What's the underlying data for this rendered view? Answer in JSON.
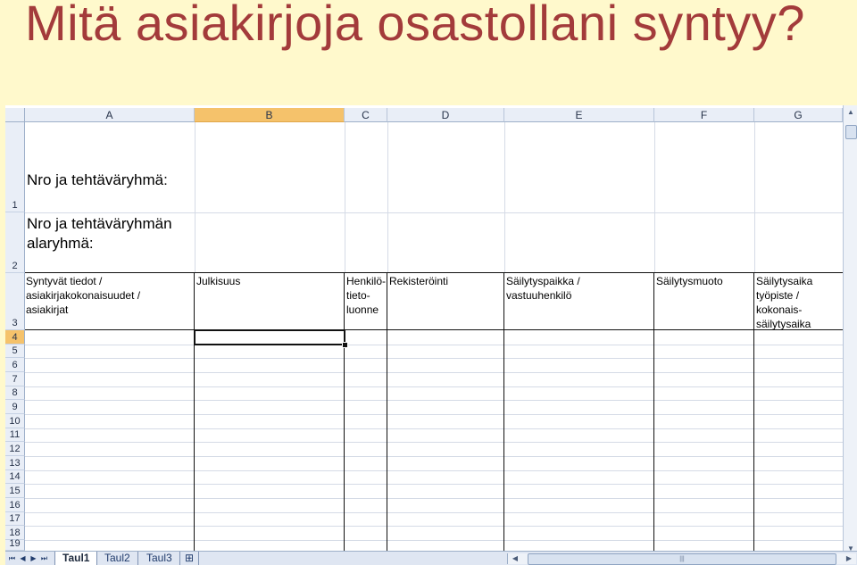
{
  "slide": {
    "title": "Mitä asiakirjoja osastollani syntyy?",
    "title_color": "#a33b3b",
    "background": "#fff9cc"
  },
  "sheet": {
    "columns": [
      "A",
      "B",
      "C",
      "D",
      "E",
      "F",
      "G"
    ],
    "selected_column": "B",
    "rows": [
      "1",
      "2",
      "3",
      "4",
      "5",
      "6",
      "7",
      "8",
      "9",
      "10",
      "11",
      "12",
      "13",
      "14",
      "15",
      "16",
      "17",
      "18",
      "19"
    ],
    "selected_row": "4",
    "cells": {
      "A1": "Nro ja tehtäväryhmä:",
      "A2_line1": "Nro ja tehtäväryhmän",
      "A2_line2": "alaryhmä:",
      "A3_line1": "Syntyvät tiedot /",
      "A3_line2": "asiakirjakokonaisuudet /",
      "A3_line3": "asiakirjat",
      "B3": "Julkisuus",
      "C3_line1": "Henkilö-",
      "C3_line2": "tieto-",
      "C3_line3": "luonne",
      "D3": "Rekisteröinti",
      "E3_line1": "Säilytyspaikka /",
      "E3_line2": "vastuuhenkilö",
      "F3": "Säilytysmuoto",
      "G3_line1": "Säilytysaika",
      "G3_line2": "työpiste /",
      "G3_line3": "kokonais-",
      "G3_line4": "säilytysaika"
    },
    "active_cell": "B4",
    "sheet_tabs": [
      "Taul1",
      "Taul2",
      "Taul3"
    ],
    "active_tab": "Taul1",
    "icons": {
      "first": "nav-first-icon",
      "prev": "nav-prev-icon",
      "next": "nav-next-icon",
      "last": "nav-last-icon",
      "insert": "insert-sheet-icon"
    }
  }
}
